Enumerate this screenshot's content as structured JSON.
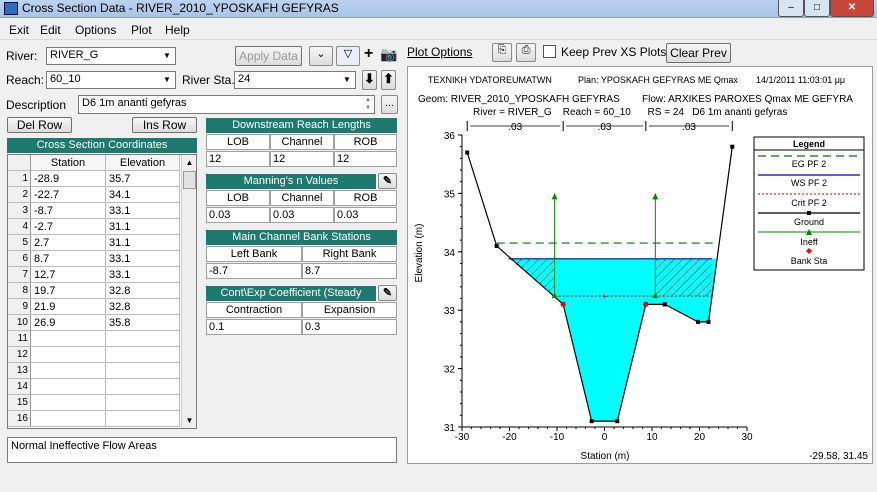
{
  "window": {
    "title": "Cross Section Data - RIVER_2010_YPOSKAFH GEFYRAS"
  },
  "menu": [
    "Exit",
    "Edit",
    "Options",
    "Plot",
    "Help"
  ],
  "form": {
    "river_label": "River:",
    "river_value": "RIVER_G",
    "reach_label": "Reach:",
    "reach_value": "60_10",
    "riversta_label": "River Sta.:",
    "riversta_value": "24",
    "description_label": "Description",
    "description_value": "D6 1m ananti gefyras",
    "apply_data": "Apply Data",
    "del_row": "Del Row",
    "ins_row": "Ins Row"
  },
  "coords": {
    "title": "Cross Section Coordinates",
    "col_station": "Station",
    "col_elevation": "Elevation",
    "rows": [
      {
        "n": "1",
        "station": "-28.9",
        "elevation": "35.7"
      },
      {
        "n": "2",
        "station": "-22.7",
        "elevation": "34.1"
      },
      {
        "n": "3",
        "station": "-8.7",
        "elevation": "33.1"
      },
      {
        "n": "4",
        "station": "-2.7",
        "elevation": "31.1"
      },
      {
        "n": "5",
        "station": "2.7",
        "elevation": "31.1"
      },
      {
        "n": "6",
        "station": "8.7",
        "elevation": "33.1"
      },
      {
        "n": "7",
        "station": "12.7",
        "elevation": "33.1"
      },
      {
        "n": "8",
        "station": "19.7",
        "elevation": "32.8"
      },
      {
        "n": "9",
        "station": "21.9",
        "elevation": "32.8"
      },
      {
        "n": "10",
        "station": "26.9",
        "elevation": "35.8"
      },
      {
        "n": "11",
        "station": "",
        "elevation": ""
      },
      {
        "n": "12",
        "station": "",
        "elevation": ""
      },
      {
        "n": "13",
        "station": "",
        "elevation": ""
      },
      {
        "n": "14",
        "station": "",
        "elevation": ""
      },
      {
        "n": "15",
        "station": "",
        "elevation": ""
      },
      {
        "n": "16",
        "station": "",
        "elevation": ""
      }
    ]
  },
  "reach_lengths": {
    "title": "Downstream Reach Lengths",
    "lob": "LOB",
    "channel": "Channel",
    "rob": "ROB",
    "lob_val": "12",
    "channel_val": "12",
    "rob_val": "12"
  },
  "mannings": {
    "title": "Manning's n Values",
    "lob": "LOB",
    "channel": "Channel",
    "rob": "ROB",
    "lob_val": "0.03",
    "channel_val": "0.03",
    "rob_val": "0.03"
  },
  "bank_stations": {
    "title": "Main Channel Bank Stations",
    "left": "Left Bank",
    "right": "Right Bank",
    "left_val": "-8.7",
    "right_val": "8.7"
  },
  "coefficients": {
    "title": "Cont\\Exp Coefficient (Steady Flow)",
    "contraction": "Contraction",
    "expansion": "Expansion",
    "contraction_val": "0.1",
    "expansion_val": "0.3"
  },
  "status_text": "Normal Ineffective Flow Areas",
  "plot_toolbar": {
    "plot_options": "Plot Options",
    "keep_prev": "Keep Prev XS Plots",
    "clear_prev": "Clear Prev"
  },
  "plot_header": {
    "line1_left": "TEXNIKH YDATOREUMATWN",
    "line1_plan": "Plan: YPOSKAFH GEFYRAS ME Qmax",
    "line1_date": "14/1/2011  11:03:01 μμ",
    "line2_geom": "Geom: RIVER_2010_YPOSKAFH GEFYRAS",
    "line2_flow": "Flow: ARXIKES PAROXES Qmax ME GEFYRA",
    "line3": "River = RIVER_G    Reach = 60_10      RS = 24   D6 1m ananti gefyras"
  },
  "coord_readout": "-29.58, 31.45",
  "colors": {
    "header_teal": "#1e7a6e",
    "water": "#00ffff",
    "eg": "#007700",
    "ws": "#0000aa",
    "crit": "#cc0000",
    "ineff": "#008800",
    "bank": "#ff0000"
  },
  "chart_data": {
    "type": "line",
    "xlabel": "Station (m)",
    "ylabel": "Elevation (m)",
    "xlim": [
      -30,
      30
    ],
    "ylim": [
      31,
      36
    ],
    "xticks": [
      "-30",
      "-20",
      "-10",
      "0",
      "10",
      "20",
      "30"
    ],
    "yticks": [
      "31",
      "32",
      "33",
      "34",
      "35",
      "36"
    ],
    "ground": {
      "x": [
        -28.9,
        -22.7,
        -8.7,
        -2.7,
        2.7,
        8.7,
        12.7,
        19.7,
        21.9,
        26.9
      ],
      "y": [
        35.7,
        34.1,
        33.1,
        31.1,
        31.1,
        33.1,
        33.1,
        32.8,
        32.8,
        35.8
      ]
    },
    "eg_pf2": 34.15,
    "ws_pf2": 33.88,
    "crit_pf2": 33.24,
    "n_values": [
      ".03",
      ".03",
      ".03"
    ],
    "bank_stations": [
      -8.7,
      8.7
    ],
    "ineffective": [
      {
        "x": -10.5,
        "y": 33.24
      },
      {
        "x": 10.7,
        "y": 33.24
      }
    ],
    "legend_title": "Legend",
    "legend": [
      "EG PF 2",
      "WS PF 2",
      "Crit PF 2",
      "Ground",
      "Ineff",
      "Bank Sta"
    ]
  }
}
